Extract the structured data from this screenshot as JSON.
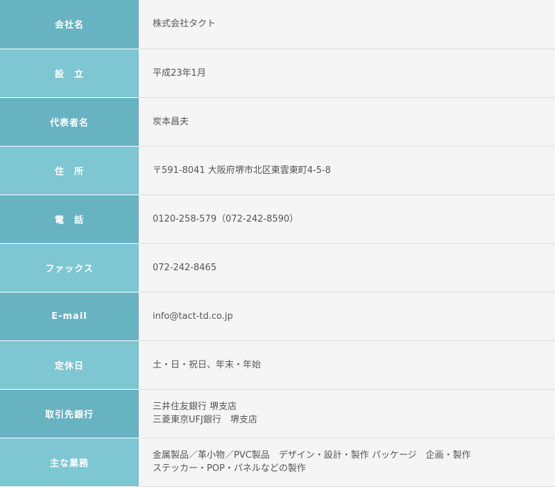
{
  "rows": [
    {
      "label": "会社名",
      "value": [
        "株式会社タクト"
      ]
    },
    {
      "label": "設　立",
      "value": [
        "平成23年1月"
      ]
    },
    {
      "label": "代表者名",
      "value": [
        "炭本昌夫"
      ]
    },
    {
      "label": "住　所",
      "value": [
        "〒591-8041 大阪府堺市北区東雲東町4-5-8"
      ]
    },
    {
      "label": "電　話",
      "value": [
        "0120-258-579（072-242-8590）"
      ]
    },
    {
      "label": "ファックス",
      "value": [
        "072-242-8465"
      ]
    },
    {
      "label": "E-mail",
      "value": [
        "info@tact-td.co.jp"
      ]
    },
    {
      "label": "定休日",
      "value": [
        "土・日・祝日、年末・年始"
      ]
    },
    {
      "label": "取引先銀行",
      "value": [
        "三井住友銀行 堺支店",
        "三菱東京UFJ銀行　堺支店"
      ]
    },
    {
      "label": "主な業務",
      "value": [
        "金属製品／革小物／PVC製品　デザイン・設計・製作 パッケージ　企画・製作",
        "ステッカー・POP・パネルなどの製作"
      ]
    }
  ],
  "colors": {
    "header_dark": "#68b3c2",
    "header_light": "#7ec6d2",
    "cell_bg": "#f4f5f4",
    "text": "#555555"
  }
}
